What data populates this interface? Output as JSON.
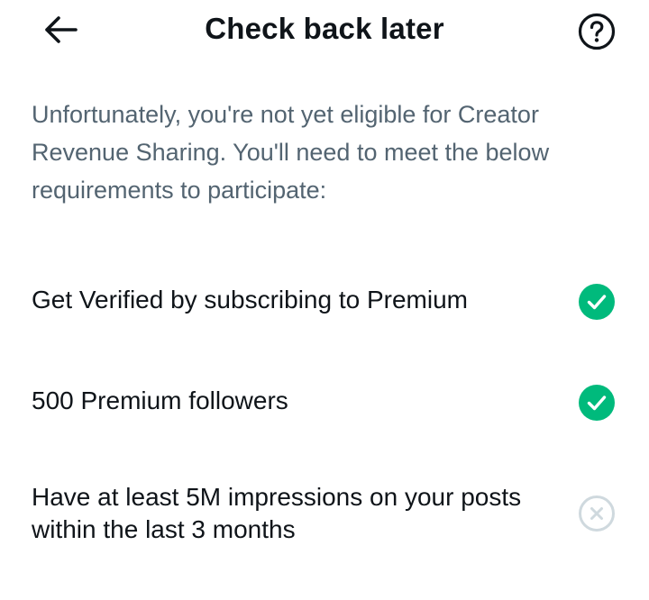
{
  "header": {
    "title": "Check back later",
    "back_icon": "arrow-left-icon",
    "help_icon": "question-circle-icon"
  },
  "intro": {
    "text": "Unfortunately, you're not yet eligible for Creator Revenue Sharing. You'll need to meet the below requirements to participate:"
  },
  "requirements": [
    {
      "label": "Get Verified by subscribing to Premium",
      "status": "met",
      "icon": "check-circle-icon"
    },
    {
      "label": "500 Premium followers",
      "status": "met",
      "icon": "check-circle-icon"
    },
    {
      "label": "Have at least 5M impressions on your posts within the last 3 months",
      "status": "not-met",
      "icon": "x-circle-icon"
    }
  ],
  "colors": {
    "text_primary": "#0f1419",
    "text_secondary": "#536471",
    "success": "#00ba7c",
    "disabled": "#cfd9de"
  }
}
